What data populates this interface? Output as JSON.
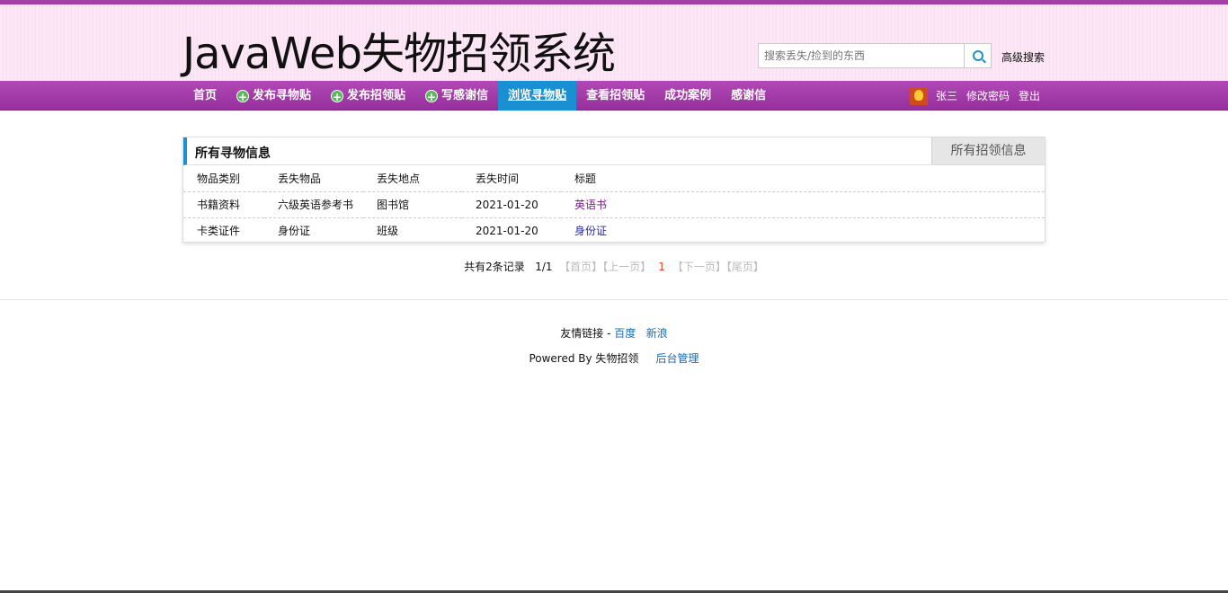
{
  "header": {
    "logo": "JavaWeb失物招领系统",
    "search_placeholder": "搜索丢失/捡到的东西",
    "advanced_search": "高级搜索"
  },
  "nav": {
    "items": [
      {
        "label": "首页"
      },
      {
        "label": "发布寻物贴"
      },
      {
        "label": "发布招领贴"
      },
      {
        "label": "写感谢信"
      },
      {
        "label": "浏览寻物贴"
      },
      {
        "label": "查看招领贴"
      },
      {
        "label": "成功案例"
      },
      {
        "label": "感谢信"
      }
    ],
    "user_name": "张三",
    "change_password": "修改密码",
    "logout": "登出"
  },
  "panel": {
    "title": "所有寻物信息",
    "tab": "所有招领信息",
    "columns": [
      "物品类别",
      "丢失物品",
      "丢失地点",
      "丢失时间",
      "标题"
    ],
    "rows": [
      [
        "书籍资料",
        "六级英语参考书",
        "图书馆",
        "2021-01-20",
        "英语书"
      ],
      [
        "卡类证件",
        "身份证",
        "班级",
        "2021-01-20",
        "身份证"
      ]
    ]
  },
  "pager": {
    "summary": "共有2条记录",
    "page_info": "1/1",
    "first": "【首页】",
    "prev": "【上一页】",
    "current": "1",
    "next": "【下一页】",
    "last": "【尾页】"
  },
  "footer": {
    "links_label": "友情链接 -",
    "link1": "百度",
    "link2": "新浪",
    "powered": "Powered By 失物招领",
    "admin": "后台管理"
  },
  "colors": {
    "nav_purple": "#a43ea8",
    "active_blue": "#1a8fd1"
  }
}
